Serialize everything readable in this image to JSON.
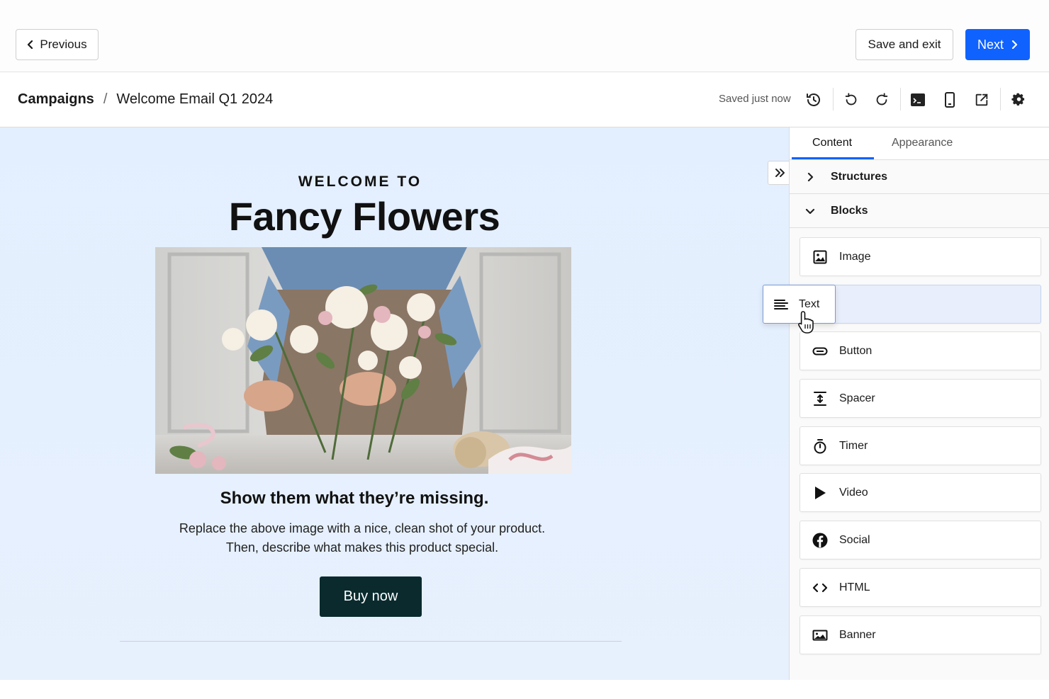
{
  "topbar": {
    "previous_label": "Previous",
    "save_exit_label": "Save and exit",
    "next_label": "Next",
    "next_color": "#0f62fe"
  },
  "breadcrumb": {
    "root": "Campaigns",
    "separator": "/",
    "current": "Welcome Email Q1 2024"
  },
  "status": {
    "saved_text": "Saved just now"
  },
  "toolbar_icons": [
    "history-icon",
    "undo-icon",
    "redo-icon",
    "desktop-preview-icon",
    "mobile-preview-icon",
    "external-preview-icon",
    "settings-icon"
  ],
  "email": {
    "eyebrow": "WELCOME TO",
    "brand": "Fancy Flowers",
    "headline": "Show them what they’re missing.",
    "body_line1": "Replace the above image with a nice, clean shot of your product.",
    "body_line2": "Then, describe what makes this product special.",
    "cta_label": "Buy now",
    "cta_color": "#0a2a2e",
    "canvas_color": "#e5effd"
  },
  "panel": {
    "tabs": [
      {
        "label": "Content",
        "active": true
      },
      {
        "label": "Appearance",
        "active": false
      }
    ],
    "sections": [
      {
        "label": "Structures",
        "expanded": false
      },
      {
        "label": "Blocks",
        "expanded": true
      }
    ],
    "blocks": [
      {
        "label": "Image",
        "icon": "image-icon"
      },
      {
        "label": "Text",
        "icon": "text-icon"
      },
      {
        "label": "Button",
        "icon": "button-icon"
      },
      {
        "label": "Spacer",
        "icon": "spacer-icon"
      },
      {
        "label": "Timer",
        "icon": "timer-icon"
      },
      {
        "label": "Video",
        "icon": "play-icon"
      },
      {
        "label": "Social",
        "icon": "facebook-icon"
      },
      {
        "label": "HTML",
        "icon": "code-icon"
      },
      {
        "label": "Banner",
        "icon": "banner-icon"
      }
    ],
    "dragging_label": "Text"
  }
}
